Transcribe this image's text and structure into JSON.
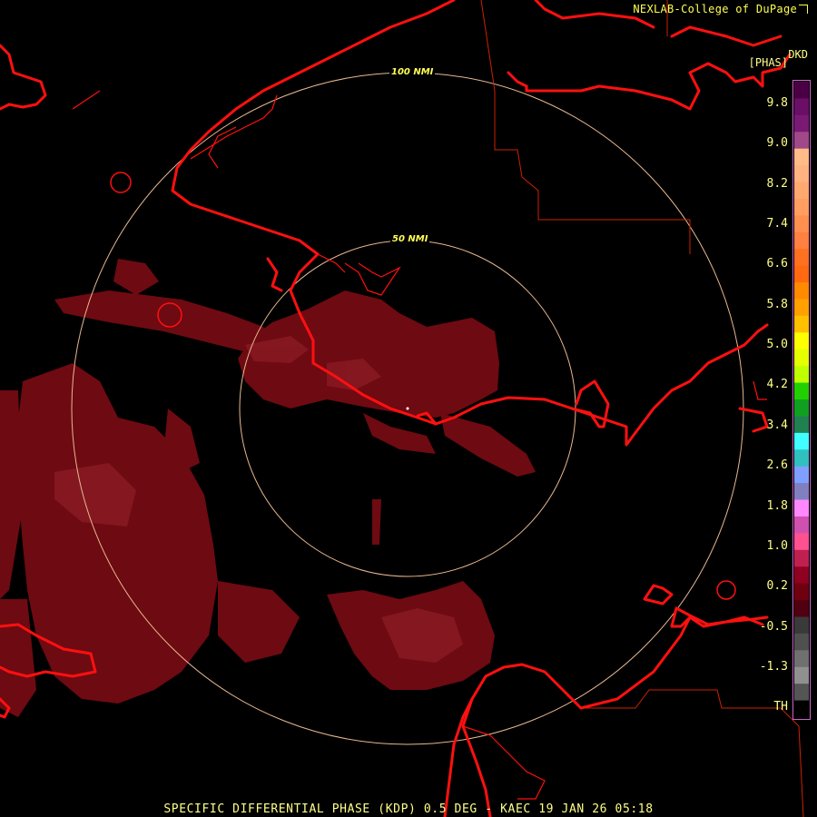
{
  "header": {
    "credit": "NEXLAB-College of DuPage",
    "product_code": "DKD",
    "unit": "[PHAS]"
  },
  "footer": {
    "caption": "SPECIFIC DIFFERENTIAL PHASE (KDP) 0.5 DEG - KAEC 19 JAN 26 05:18"
  },
  "range_rings": [
    {
      "label": "50 NMI",
      "range_nmi": 50
    },
    {
      "label": "100 NMI",
      "range_nmi": 100
    }
  ],
  "color_scale": {
    "labels": [
      "9.8",
      "9.0",
      "8.2",
      "7.4",
      "6.6",
      "5.8",
      "5.0",
      "4.2",
      "3.4",
      "2.6",
      "1.8",
      "1.0",
      "0.2",
      "-0.5",
      "-1.3",
      "TH"
    ],
    "colors": [
      "#4b0046",
      "#6a0e66",
      "#7a1a74",
      "#a04888",
      "#ffbb88",
      "#ffb380",
      "#ffa870",
      "#ff9e60",
      "#ff9050",
      "#ff8040",
      "#ff7020",
      "#ff6a10",
      "#ff8a00",
      "#ffa000",
      "#ffc000",
      "#ffff00",
      "#e6ff00",
      "#c0ff00",
      "#20d000",
      "#10a020",
      "#208050",
      "#40ffff",
      "#30c0c0",
      "#80a0ff",
      "#8080c0",
      "#ff88ff",
      "#d050b0",
      "#ff5090",
      "#c02050",
      "#900020",
      "#700010",
      "#500010",
      "#3a3a3a",
      "#505050",
      "#707070",
      "#909090",
      "#555555",
      "#000000"
    ]
  },
  "colors": {
    "background": "#000000",
    "coastline": "#ff1010",
    "boundary": "#cc2200",
    "range_ring": "#e8b890",
    "echo": "#6e0a12",
    "echo_light": "#8a1a24",
    "label": "#ffff55"
  },
  "radar_site": "KAEC"
}
